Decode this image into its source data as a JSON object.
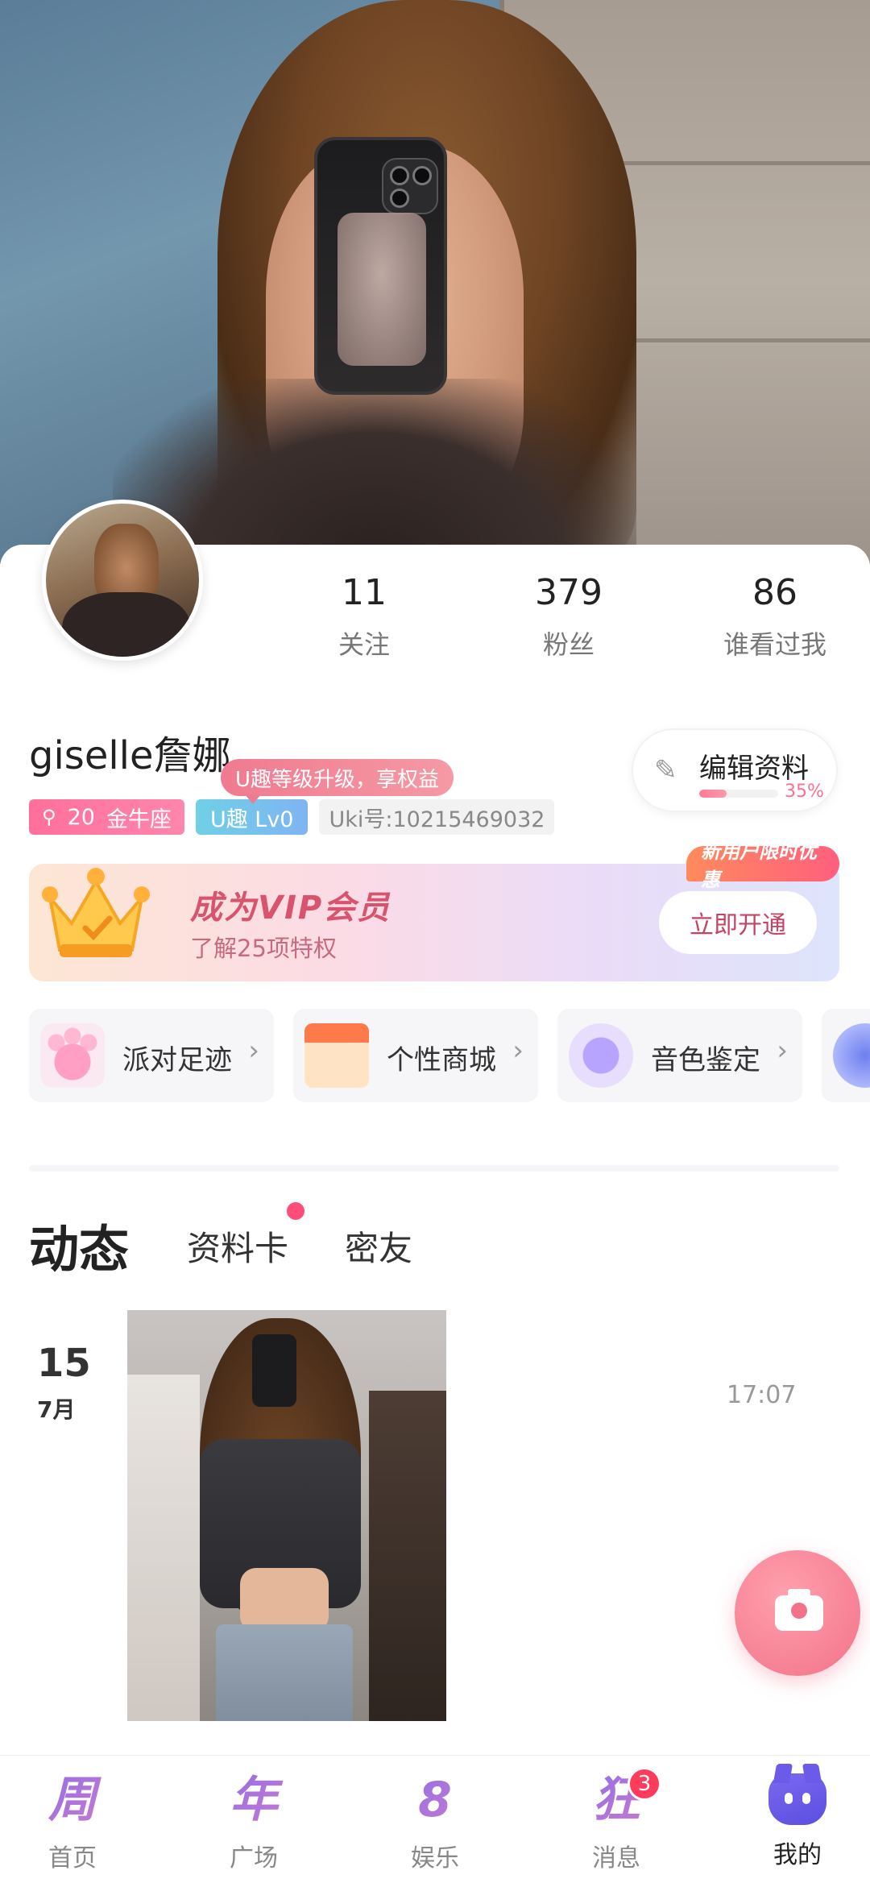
{
  "profile": {
    "username": "giselle詹娜",
    "stats": [
      {
        "value": "11",
        "label": "关注"
      },
      {
        "value": "379",
        "label": "粉丝"
      },
      {
        "value": "86",
        "label": "谁看过我"
      }
    ],
    "tags": {
      "age": "20",
      "zodiac": "金牛座",
      "level": "U趣 Lv0",
      "uki_id": "Uki号:10215469032"
    },
    "level_tooltip": "U趣等级升级，享权益",
    "edit": {
      "label": "编辑资料",
      "progress_text": "35%",
      "progress": 0.35
    }
  },
  "vip": {
    "title": "成为VIP会员",
    "subtitle": "了解25项特权",
    "button": "立即开通",
    "badge": "新用户限时优惠"
  },
  "features": [
    {
      "label": "派对足迹",
      "icon": "paw-icon"
    },
    {
      "label": "个性商城",
      "icon": "shop-icon"
    },
    {
      "label": "音色鉴定",
      "icon": "voice-wave-icon"
    }
  ],
  "tabs": {
    "active": "动态",
    "items": [
      "资料卡",
      "密友"
    ]
  },
  "post": {
    "day": "15",
    "month": "7月",
    "time": "17:07"
  },
  "bottom_nav": [
    {
      "label": "首页",
      "glyph": "周",
      "icon": "home-icon"
    },
    {
      "label": "广场",
      "glyph": "年",
      "icon": "plaza-icon"
    },
    {
      "label": "娱乐",
      "glyph": "8",
      "icon": "entertainment-icon"
    },
    {
      "label": "消息",
      "glyph": "狂",
      "icon": "message-icon",
      "badge": "3"
    },
    {
      "label": "我的",
      "icon": "mine-icon",
      "active": true
    }
  ],
  "colors": {
    "accent_pink": "#ff6f9c",
    "level_blue": "#7fb4f3",
    "vip_text": "#d8546c",
    "badge_red": "#ff3b5c"
  }
}
